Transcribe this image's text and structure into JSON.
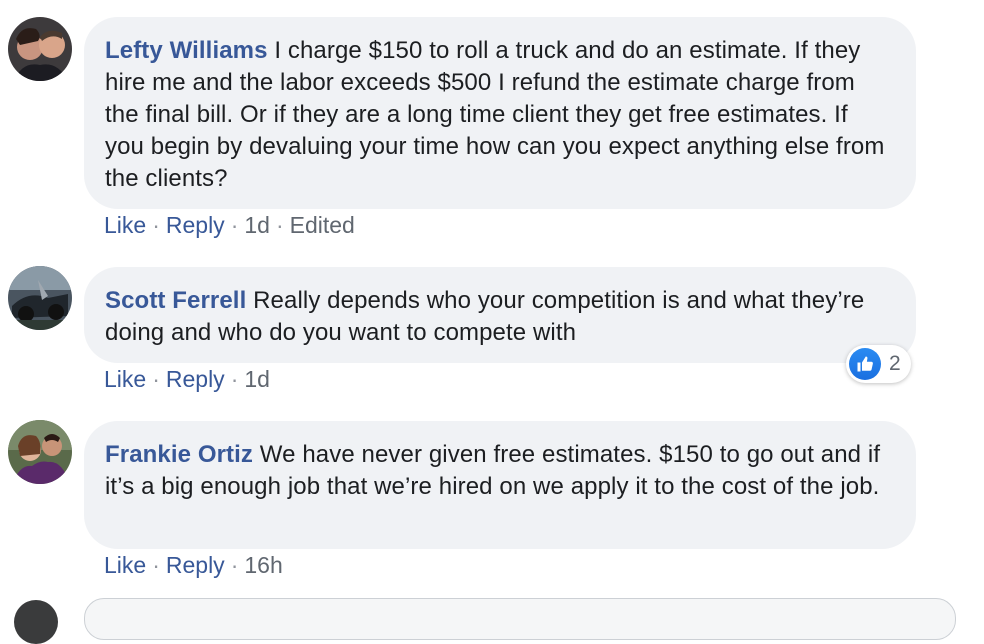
{
  "comments": [
    {
      "author": "Lefty Williams",
      "text": "I charge $150 to roll a truck and do an estimate. If they hire me and the labor exceeds $500 I refund the estimate charge from the final bill. Or if they are a long time client they get free estimates. If you begin by devaluing your time how can you expect anything else from the clients?",
      "like_label": "Like",
      "reply_label": "Reply",
      "time": "1d",
      "edited": "Edited"
    },
    {
      "author": "Scott Ferrell",
      "text": "Really depends who your competition is and what they’re doing and who do you want to compete with",
      "like_label": "Like",
      "reply_label": "Reply",
      "time": "1d",
      "reaction_count": "2",
      "reaction_icon": "thumbs-up-icon"
    },
    {
      "author": "Frankie Ortiz",
      "text": "We have never given free estimates. $150 to go out and if it’s a big enough job that we’re hired on we apply it to the cost of the job.",
      "like_label": "Like",
      "reply_label": "Reply",
      "time": "16h"
    }
  ],
  "colors": {
    "author": "#385898",
    "bubble": "#f0f2f5",
    "text": "#1c1e21",
    "meta": "#606770",
    "like_blue": "#1877f2"
  }
}
